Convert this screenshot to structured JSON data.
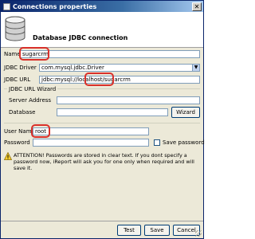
{
  "window": {
    "title": "Connections properties",
    "close_glyph": "✕"
  },
  "header": {
    "title": "Database JDBC connection"
  },
  "form": {
    "name_label": "Name",
    "name_value": "sugarcrm",
    "driver_label": "JDBC Driver",
    "driver_value": "com.mysql.jdbc.Driver",
    "url_label": "JDBC URL",
    "url_value": "jdbc:mysql://localhost/sugarcrm",
    "wizard_group_label": "JDBC URL Wizard",
    "server_label": "Server Address",
    "server_value": "",
    "database_label": "Database",
    "database_value": "",
    "wizard_button": "Wizard",
    "username_label": "User Name",
    "username_value": "root",
    "password_label": "Password",
    "password_value": "",
    "save_password_label": "Save password",
    "save_password_checked": false
  },
  "warning": {
    "text": "ATTENTION! Passwords are stored in clear text. If you dont specify a password now, iReport will ask you for one only when required and will save it."
  },
  "buttons": {
    "test": "Test",
    "save": "Save",
    "cancel": "Cancel"
  },
  "colors": {
    "highlight": "#d9302a",
    "titlebar": "#0a246a",
    "dialog_bg": "#ece9d8"
  }
}
